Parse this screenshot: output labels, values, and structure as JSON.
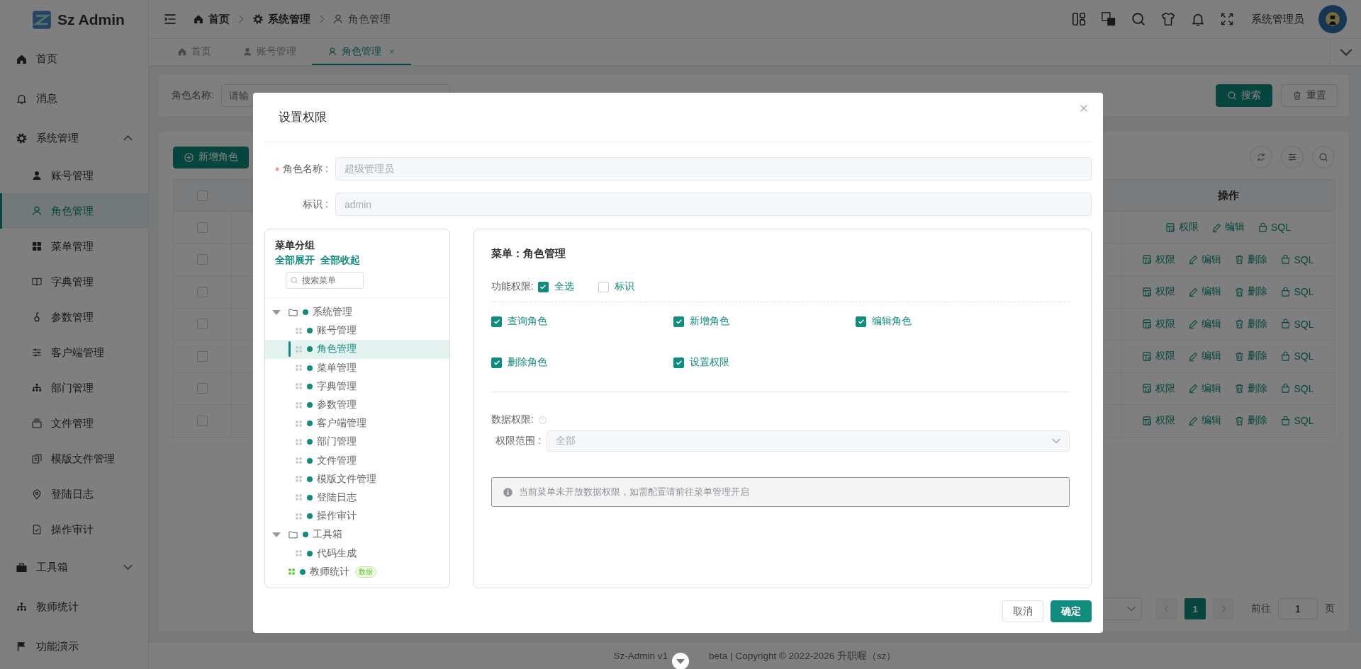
{
  "sidebar": {
    "logo": "Sz Admin",
    "items": [
      {
        "label": "首页",
        "selected": false
      },
      {
        "label": "消息",
        "selected": false
      },
      {
        "label": "系统管理",
        "selected": false,
        "expanded": true,
        "children": [
          {
            "label": "账号管理",
            "selected": false
          },
          {
            "label": "角色管理",
            "selected": true
          },
          {
            "label": "菜单管理",
            "selected": false
          },
          {
            "label": "字典管理",
            "selected": false
          },
          {
            "label": "参数管理",
            "selected": false
          },
          {
            "label": "客户端管理",
            "selected": false
          },
          {
            "label": "部门管理",
            "selected": false
          },
          {
            "label": "文件管理",
            "selected": false
          },
          {
            "label": "模版文件管理",
            "selected": false
          },
          {
            "label": "登陆日志",
            "selected": false
          },
          {
            "label": "操作审计",
            "selected": false
          }
        ]
      },
      {
        "label": "工具箱",
        "selected": false,
        "expanded": false
      },
      {
        "label": "教师统计",
        "selected": false
      },
      {
        "label": "功能演示",
        "selected": false
      }
    ]
  },
  "header": {
    "breadcrumb": [
      "首页",
      "系统管理",
      "角色管理"
    ],
    "user": "系统管理员"
  },
  "tabs": [
    {
      "label": "首页",
      "selected": false
    },
    {
      "label": "账号管理",
      "selected": false
    },
    {
      "label": "角色管理",
      "selected": true
    }
  ],
  "search_form": {
    "label": "角色名称:",
    "placeholder": "请输",
    "buttons": [
      {
        "label": "搜索",
        "kind": "primary"
      },
      {
        "label": "重置",
        "kind": "default"
      }
    ]
  },
  "table": {
    "add_button": "新增角色",
    "header_checked": false,
    "columns": [
      {
        "label": "操作"
      }
    ],
    "rows": [
      {
        "checked": false,
        "actions": [
          {
            "label": "权限",
            "kind": "perm"
          },
          {
            "label": "编辑",
            "kind": "edit"
          },
          {
            "label": "SQL",
            "kind": "sql"
          }
        ]
      },
      {
        "checked": false,
        "actions": [
          {
            "label": "权限",
            "kind": "perm"
          },
          {
            "label": "编辑",
            "kind": "edit"
          },
          {
            "label": "删除",
            "kind": "delete"
          },
          {
            "label": "SQL",
            "kind": "sql"
          }
        ]
      },
      {
        "checked": false,
        "actions": [
          {
            "label": "权限",
            "kind": "perm"
          },
          {
            "label": "编辑",
            "kind": "edit"
          },
          {
            "label": "删除",
            "kind": "delete"
          },
          {
            "label": "SQL",
            "kind": "sql"
          }
        ]
      },
      {
        "checked": false,
        "actions": [
          {
            "label": "权限",
            "kind": "perm"
          },
          {
            "label": "编辑",
            "kind": "edit"
          },
          {
            "label": "删除",
            "kind": "delete"
          },
          {
            "label": "SQL",
            "kind": "sql"
          }
        ]
      },
      {
        "checked": false,
        "actions": [
          {
            "label": "权限",
            "kind": "perm"
          },
          {
            "label": "编辑",
            "kind": "edit"
          },
          {
            "label": "删除",
            "kind": "delete"
          },
          {
            "label": "SQL",
            "kind": "sql"
          }
        ]
      },
      {
        "checked": false,
        "actions": [
          {
            "label": "权限",
            "kind": "perm"
          },
          {
            "label": "编辑",
            "kind": "edit"
          },
          {
            "label": "删除",
            "kind": "delete"
          },
          {
            "label": "SQL",
            "kind": "sql"
          }
        ]
      },
      {
        "checked": false,
        "actions": [
          {
            "label": "权限",
            "kind": "perm"
          },
          {
            "label": "编辑",
            "kind": "edit"
          },
          {
            "label": "删除",
            "kind": "delete"
          },
          {
            "label": "SQL",
            "kind": "sql"
          }
        ]
      }
    ]
  },
  "pagination": {
    "pages": [
      {
        "label": "1",
        "selected": true
      }
    ],
    "goto_label": "前往",
    "goto_value": "1",
    "suffix": "页"
  },
  "footer": {
    "text_1": "Sz-Admin v1",
    "text_2": "beta | Copyright © 2022-2026 升职喔（sz）"
  },
  "modal": {
    "title": "设置权限",
    "form": [
      {
        "label": "角色名称 :",
        "required": true,
        "value": "超级管理员",
        "disabled": true
      },
      {
        "label": "标识 :",
        "required": false,
        "value": "admin",
        "disabled": true
      }
    ],
    "menu_tree": {
      "title": "菜单分组",
      "links": [
        "全部展开",
        "全部收起"
      ],
      "search_placeholder": "搜索菜单",
      "nodes": [
        {
          "label": "系统管理",
          "kind": "folder",
          "selected": false,
          "expanded": true,
          "children": [
            {
              "label": "账号管理",
              "kind": "menu",
              "color": "#c0c4cc",
              "selected": false
            },
            {
              "label": "角色管理",
              "kind": "menu",
              "color": "#c0c4cc",
              "selected": true
            },
            {
              "label": "菜单管理",
              "kind": "menu",
              "color": "#c0c4cc",
              "selected": false
            },
            {
              "label": "字典管理",
              "kind": "menu",
              "color": "#c0c4cc",
              "selected": false
            },
            {
              "label": "参数管理",
              "kind": "menu",
              "color": "#c0c4cc",
              "selected": false
            },
            {
              "label": "客户端管理",
              "kind": "menu",
              "color": "#c0c4cc",
              "selected": false
            },
            {
              "label": "部门管理",
              "kind": "menu",
              "color": "#c0c4cc",
              "selected": false
            },
            {
              "label": "文件管理",
              "kind": "menu",
              "color": "#c0c4cc",
              "selected": false
            },
            {
              "label": "模版文件管理",
              "kind": "menu",
              "color": "#c0c4cc",
              "selected": false
            },
            {
              "label": "登陆日志",
              "kind": "menu",
              "color": "#c0c4cc",
              "selected": false
            },
            {
              "label": "操作审计",
              "kind": "menu",
              "color": "#c0c4cc",
              "selected": false
            }
          ]
        },
        {
          "label": "工具箱",
          "kind": "folder",
          "selected": false,
          "expanded": true,
          "children": [
            {
              "label": "代码生成",
              "kind": "menu",
              "color": "#c0c4cc",
              "selected": false
            }
          ]
        },
        {
          "label": "教师统计",
          "kind": "menu",
          "color": "#52c41a",
          "selected": false,
          "tag": "数据"
        }
      ]
    },
    "detail": {
      "title": "菜单：角色管理",
      "function_label": "功能权限:",
      "function_options": [
        {
          "label": "全选",
          "checked": true
        },
        {
          "label": "标识",
          "checked": false
        }
      ],
      "permissions": [
        {
          "label": "查询角色",
          "checked": true
        },
        {
          "label": "新增角色",
          "checked": true
        },
        {
          "label": "编辑角色",
          "checked": true
        },
        {
          "label": "删除角色",
          "checked": true
        },
        {
          "label": "设置权限",
          "checked": true
        }
      ],
      "data_label": "数据权限:",
      "scope_label": "权限范围 :",
      "scope_value": "全部",
      "scope_disabled": true,
      "notice": "当前菜单未开放数据权限，如需配置请前往菜单管理开启"
    },
    "buttons": [
      {
        "label": "取消",
        "kind": "default"
      },
      {
        "label": "确定",
        "kind": "primary"
      }
    ]
  }
}
